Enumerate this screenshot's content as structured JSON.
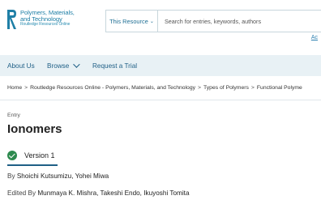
{
  "header": {
    "logo": {
      "line1": "Polymers, Materials,",
      "line2": "and Technology",
      "line3": "Routledge Resources Online"
    },
    "search": {
      "scope_label": "This Resource",
      "placeholder": "Search for entries, keywords, authors"
    },
    "top_link_label": "Ac"
  },
  "nav": {
    "items": [
      {
        "label": "About Us"
      },
      {
        "label": "Browse"
      },
      {
        "label": "Request a Trial"
      }
    ]
  },
  "breadcrumb": {
    "items": [
      "Home",
      "Routledge Resources Online - Polymers, Materials, and Technology",
      "Types of Polymers",
      "Functional Polyme"
    ],
    "separator": ">"
  },
  "entry": {
    "label": "Entry",
    "title": "Ionomers",
    "version": "Version 1",
    "by_prefix": "By",
    "authors": "Shoichi Kutsumizu, Yohei Miwa",
    "edited_prefix": "Edited By",
    "editors": "Munmaya K. Mishra, Takeshi Endo, Ikuyoshi Tomita"
  },
  "colors": {
    "brand": "#1f7fa6",
    "nav_background": "#e8f1f5",
    "nav_text": "#1f5f86",
    "check_green": "#2d8a4e"
  }
}
